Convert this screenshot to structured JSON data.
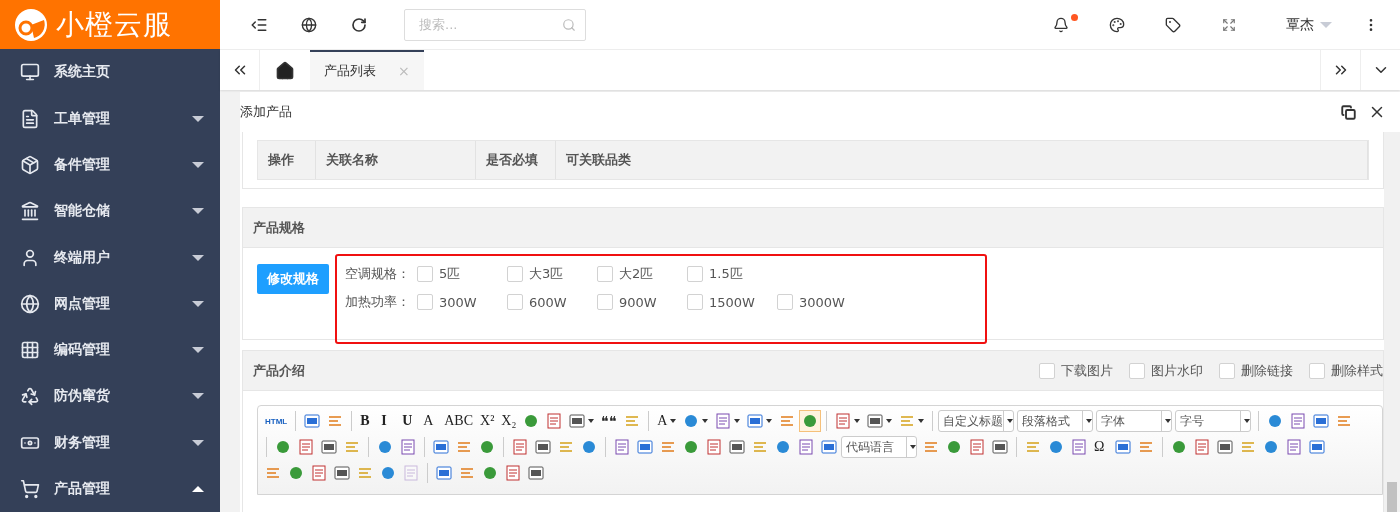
{
  "logo": {
    "text": "小橙云服"
  },
  "sidebar": {
    "items": [
      {
        "label": "系统主页",
        "kind": "link",
        "selected": false
      },
      {
        "label": "工单管理",
        "kind": "group",
        "expanded": false
      },
      {
        "label": "备件管理",
        "kind": "group",
        "expanded": false
      },
      {
        "label": "智能仓储",
        "kind": "group",
        "expanded": false
      },
      {
        "label": "终端用户",
        "kind": "group",
        "expanded": false
      },
      {
        "label": "网点管理",
        "kind": "group",
        "expanded": false
      },
      {
        "label": "编码管理",
        "kind": "group",
        "expanded": false
      },
      {
        "label": "防伪窜货",
        "kind": "group",
        "expanded": false
      },
      {
        "label": "财务管理",
        "kind": "group",
        "expanded": false
      },
      {
        "label": "产品管理",
        "kind": "group",
        "expanded": true
      }
    ]
  },
  "header": {
    "search": {
      "placeholder": "搜索..."
    },
    "notifications": {
      "unread": true
    },
    "user": "覃杰"
  },
  "tabs": [
    {
      "kind": "home",
      "selected": false
    },
    {
      "kind": "page",
      "label": "产品列表",
      "close": "×",
      "selected": true
    }
  ],
  "panel": {
    "title": "添加产品",
    "relation_table": {
      "columns": [
        "操作",
        "关联名称",
        "是否必填",
        "可关联品类"
      ]
    },
    "spec": {
      "title": "产品规格",
      "button": "修改规格",
      "highlighted": true,
      "groups": [
        {
          "label": "空调规格：",
          "options": [
            {
              "label": "5匹",
              "checked": false
            },
            {
              "label": "大3匹",
              "checked": false
            },
            {
              "label": "大2匹",
              "checked": false
            },
            {
              "label": "1.5匹",
              "checked": false
            }
          ]
        },
        {
          "label": "加热功率：",
          "options": [
            {
              "label": "300W",
              "checked": false
            },
            {
              "label": "600W",
              "checked": false
            },
            {
              "label": "900W",
              "checked": false
            },
            {
              "label": "1500W",
              "checked": false
            },
            {
              "label": "3000W",
              "checked": false
            }
          ]
        }
      ]
    },
    "intro": {
      "title": "产品介绍",
      "options": [
        {
          "label": "下载图片",
          "checked": false
        },
        {
          "label": "图片水印",
          "checked": false
        },
        {
          "label": "删除链接",
          "checked": false
        },
        {
          "label": "删除样式",
          "checked": false
        }
      ],
      "toolbar": [
        [
          {
            "kind": "text",
            "label": "HTML"
          },
          {
            "kind": "separator"
          },
          {
            "kind": "icon"
          },
          {
            "kind": "icon"
          },
          {
            "kind": "separator"
          },
          {
            "kind": "text",
            "label": "B"
          },
          {
            "kind": "text",
            "label": "I"
          },
          {
            "kind": "text",
            "label": "U"
          },
          {
            "kind": "text",
            "label": "A"
          },
          {
            "kind": "text",
            "label": "ABC"
          },
          {
            "kind": "text",
            "label": "X²"
          },
          {
            "kind": "text",
            "label": "X₂"
          },
          {
            "kind": "icon"
          },
          {
            "kind": "icon"
          },
          {
            "kind": "icon",
            "dropdown": true
          },
          {
            "kind": "text",
            "label": "❝❝"
          },
          {
            "kind": "icon"
          },
          {
            "kind": "separator"
          },
          {
            "kind": "text",
            "label": "A",
            "dropdown": true
          },
          {
            "kind": "icon",
            "dropdown": true
          },
          {
            "kind": "icon",
            "dropdown": true
          },
          {
            "kind": "icon",
            "dropdown": true
          },
          {
            "kind": "icon"
          },
          {
            "kind": "icon",
            "selected": true
          },
          {
            "kind": "separator"
          },
          {
            "kind": "icon",
            "dropdown": true
          },
          {
            "kind": "icon",
            "dropdown": true
          },
          {
            "kind": "icon",
            "dropdown": true
          },
          {
            "kind": "separator"
          },
          {
            "kind": "select",
            "label": "自定义标题"
          },
          {
            "kind": "select",
            "label": "段落格式"
          },
          {
            "kind": "select",
            "label": "字体"
          },
          {
            "kind": "select",
            "label": "字号"
          },
          {
            "kind": "separator"
          },
          {
            "kind": "icon"
          },
          {
            "kind": "icon"
          },
          {
            "kind": "icon"
          },
          {
            "kind": "icon"
          }
        ],
        [
          {
            "kind": "separator"
          },
          {
            "kind": "icon"
          },
          {
            "kind": "icon"
          },
          {
            "kind": "icon"
          },
          {
            "kind": "icon"
          },
          {
            "kind": "separator"
          },
          {
            "kind": "icon"
          },
          {
            "kind": "icon"
          },
          {
            "kind": "separator"
          },
          {
            "kind": "icon"
          },
          {
            "kind": "icon"
          },
          {
            "kind": "icon"
          },
          {
            "kind": "separator"
          },
          {
            "kind": "icon"
          },
          {
            "kind": "icon"
          },
          {
            "kind": "icon"
          },
          {
            "kind": "icon"
          },
          {
            "kind": "separator"
          },
          {
            "kind": "icon"
          },
          {
            "kind": "icon"
          },
          {
            "kind": "icon"
          },
          {
            "kind": "icon"
          },
          {
            "kind": "icon"
          },
          {
            "kind": "icon"
          },
          {
            "kind": "icon"
          },
          {
            "kind": "icon"
          },
          {
            "kind": "icon"
          },
          {
            "kind": "icon"
          },
          {
            "kind": "select",
            "label": "代码语言"
          },
          {
            "kind": "icon"
          },
          {
            "kind": "icon"
          },
          {
            "kind": "icon"
          },
          {
            "kind": "icon"
          },
          {
            "kind": "separator"
          },
          {
            "kind": "icon"
          },
          {
            "kind": "icon"
          },
          {
            "kind": "icon"
          },
          {
            "kind": "text",
            "label": "Ω"
          },
          {
            "kind": "icon"
          },
          {
            "kind": "icon"
          },
          {
            "kind": "separator"
          },
          {
            "kind": "icon"
          },
          {
            "kind": "icon"
          },
          {
            "kind": "icon"
          },
          {
            "kind": "icon"
          },
          {
            "kind": "icon"
          },
          {
            "kind": "icon"
          },
          {
            "kind": "icon"
          }
        ],
        [
          {
            "kind": "icon"
          },
          {
            "kind": "icon"
          },
          {
            "kind": "icon"
          },
          {
            "kind": "icon"
          },
          {
            "kind": "icon"
          },
          {
            "kind": "icon"
          },
          {
            "kind": "icon",
            "disabled": true
          },
          {
            "kind": "separator"
          },
          {
            "kind": "icon"
          },
          {
            "kind": "icon"
          },
          {
            "kind": "icon"
          },
          {
            "kind": "icon"
          },
          {
            "kind": "icon"
          }
        ]
      ]
    }
  }
}
